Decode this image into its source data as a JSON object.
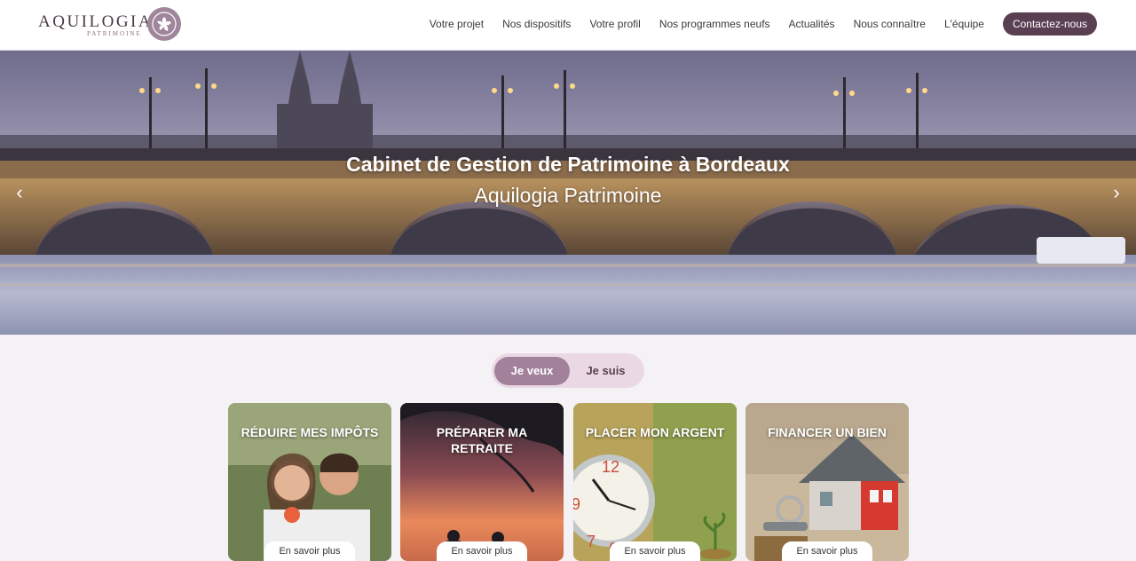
{
  "brand": {
    "name": "AQUILOGIA",
    "tagline": "PATRIMOINE",
    "accent": "#5a3f52",
    "mark_color": "#a0869b"
  },
  "nav": {
    "items": [
      {
        "label": "Votre projet"
      },
      {
        "label": "Nos dispositifs"
      },
      {
        "label": "Votre profil"
      },
      {
        "label": "Nos programmes neufs"
      },
      {
        "label": "Actualités"
      },
      {
        "label": "Nous connaître"
      },
      {
        "label": "L'équipe"
      }
    ],
    "cta": "Contactez-nous"
  },
  "hero": {
    "title": "Cabinet de Gestion de Patrimoine à Bordeaux",
    "subtitle": "Aquilogia Patrimoine",
    "prev_icon": "chevron-left-icon",
    "next_icon": "chevron-right-icon"
  },
  "toggle": {
    "active": "Je veux",
    "inactive": "Je suis"
  },
  "cards": [
    {
      "title": "RÉDUIRE MES IMPÔTS",
      "button": "En savoir plus"
    },
    {
      "title": "PRÉPARER MA RETRAITE",
      "button": "En savoir plus"
    },
    {
      "title": "PLACER MON ARGENT",
      "button": "En savoir plus"
    },
    {
      "title": "FINANCER UN BIEN",
      "button": "En savoir plus"
    }
  ]
}
